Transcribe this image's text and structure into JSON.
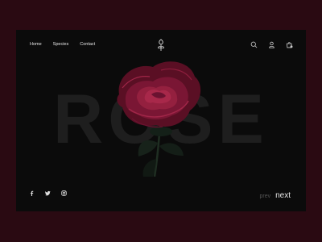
{
  "nav": {
    "items": [
      {
        "label": "Home"
      },
      {
        "label": "Species"
      },
      {
        "label": "Contact"
      }
    ]
  },
  "hero": {
    "word": "ROSE"
  },
  "header_icons": [
    "search-icon",
    "user-icon",
    "cart-icon"
  ],
  "social_icons": [
    "facebook-icon",
    "twitter-icon",
    "instagram-icon"
  ],
  "pager": {
    "prev_label": "prev",
    "next_label": "next"
  },
  "colors": {
    "outer_background": "#2a0a12",
    "panel_background": "#0b0b0b",
    "rose_petal": "#7a1634",
    "background_word": "#1e1e1e",
    "text": "#e8e8e8"
  }
}
